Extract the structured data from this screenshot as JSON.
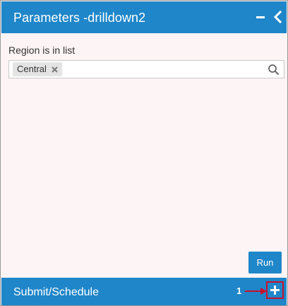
{
  "panel": {
    "title": "Parameters -drilldown2",
    "minimize_icon": "minus-icon",
    "collapse_icon": "chevron-left-icon"
  },
  "parameter": {
    "label": "Region is in list",
    "selected_values": [
      "Central"
    ],
    "remove_icon": "close-icon",
    "search_icon": "search-icon"
  },
  "actions": {
    "run_label": "Run"
  },
  "footer": {
    "title": "Submit/Schedule",
    "annotation_number": "1",
    "add_icon": "plus-icon",
    "annotation_color": "#c8102e"
  },
  "colors": {
    "accent": "#1f86c9",
    "panel_background": "#fcf4f5",
    "chip_background": "#e4e4e4"
  }
}
